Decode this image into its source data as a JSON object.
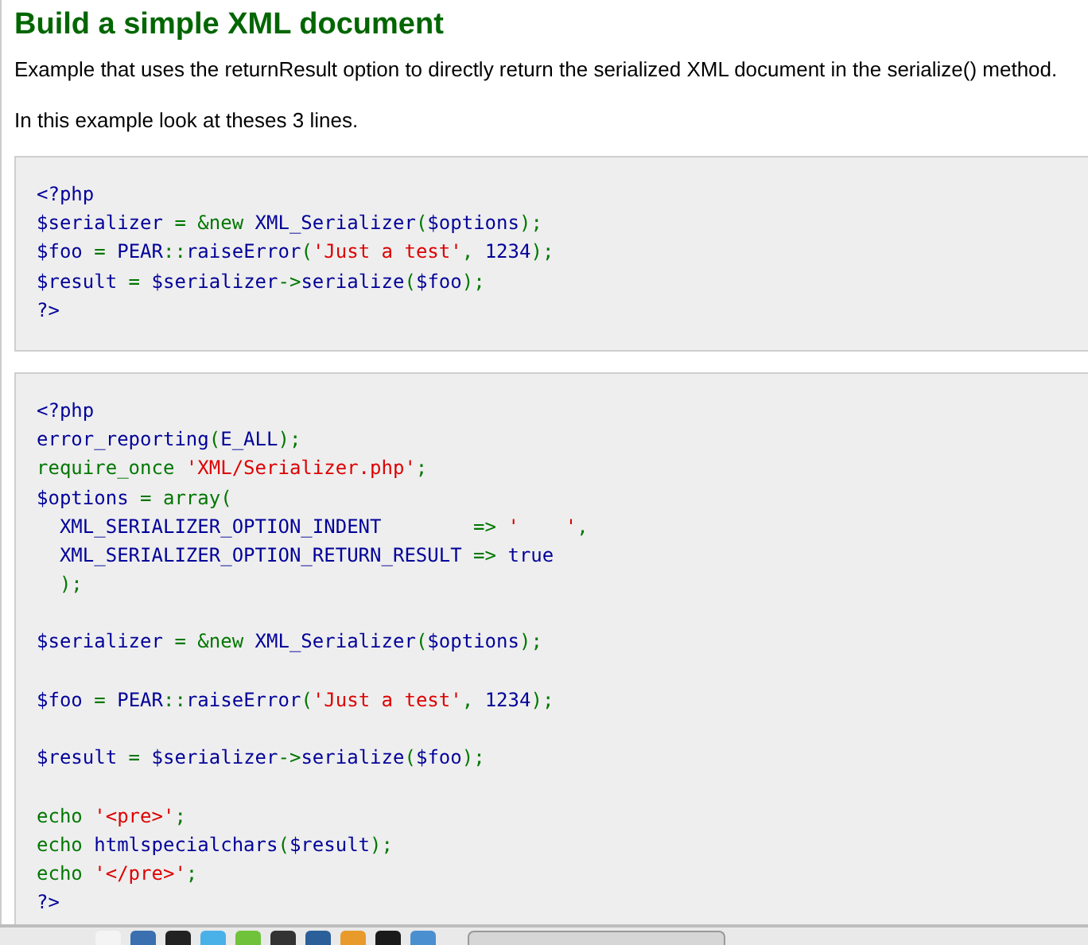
{
  "heading": "Build a simple XML document",
  "paragraphs": [
    "Example that uses the returnResult option to directly return the serialized XML document in the serialize() method.",
    "In this example look at theses 3 lines."
  ],
  "code_blocks": [
    {
      "sections": [
        {
          "lines": [
            [
              {
                "text": "<?php",
                "kind": "plain"
              }
            ],
            [
              {
                "text": "$serializer",
                "kind": "plain"
              },
              {
                "text": " = &new ",
                "kind": "keyword"
              },
              {
                "text": "XML_Serializer",
                "kind": "plain"
              },
              {
                "text": "(",
                "kind": "keyword"
              },
              {
                "text": "$options",
                "kind": "plain"
              },
              {
                "text": ");",
                "kind": "keyword"
              }
            ],
            [
              {
                "text": "$foo",
                "kind": "plain"
              },
              {
                "text": " = ",
                "kind": "keyword"
              },
              {
                "text": "PEAR",
                "kind": "plain"
              },
              {
                "text": "::",
                "kind": "keyword"
              },
              {
                "text": "raiseError",
                "kind": "plain"
              },
              {
                "text": "(",
                "kind": "keyword"
              },
              {
                "text": "'Just a test'",
                "kind": "string"
              },
              {
                "text": ", ",
                "kind": "keyword"
              },
              {
                "text": "1234",
                "kind": "plain"
              },
              {
                "text": ");",
                "kind": "keyword"
              }
            ],
            [
              {
                "text": "$result",
                "kind": "plain"
              },
              {
                "text": " = ",
                "kind": "keyword"
              },
              {
                "text": "$serializer",
                "kind": "plain"
              },
              {
                "text": "->",
                "kind": "keyword"
              },
              {
                "text": "serialize",
                "kind": "plain"
              },
              {
                "text": "(",
                "kind": "keyword"
              },
              {
                "text": "$foo",
                "kind": "plain"
              },
              {
                "text": ");",
                "kind": "keyword"
              }
            ],
            [
              {
                "text": "?>",
                "kind": "plain"
              }
            ]
          ]
        }
      ]
    },
    {
      "sections": [
        {
          "lines": [
            [
              {
                "text": "<?php",
                "kind": "plain"
              }
            ],
            [
              {
                "text": "error_reporting",
                "kind": "plain"
              },
              {
                "text": "(",
                "kind": "keyword"
              },
              {
                "text": "E_ALL",
                "kind": "plain"
              },
              {
                "text": ");",
                "kind": "keyword"
              }
            ],
            [
              {
                "text": "require_once ",
                "kind": "keyword"
              },
              {
                "text": "'XML/Serializer.php'",
                "kind": "string"
              },
              {
                "text": ";",
                "kind": "keyword"
              }
            ],
            [
              {
                "text": "$options",
                "kind": "plain"
              },
              {
                "text": " = ",
                "kind": "keyword"
              },
              {
                "text": "array",
                "kind": "keyword"
              },
              {
                "text": "(",
                "kind": "keyword"
              }
            ],
            [
              {
                "text": "  XML_SERIALIZER_OPTION_INDENT        ",
                "kind": "plain"
              },
              {
                "text": "=> ",
                "kind": "keyword"
              },
              {
                "text": "'    '",
                "kind": "string"
              },
              {
                "text": ",",
                "kind": "keyword"
              }
            ],
            [
              {
                "text": "  XML_SERIALIZER_OPTION_RETURN_RESULT ",
                "kind": "plain"
              },
              {
                "text": "=> ",
                "kind": "keyword"
              },
              {
                "text": "true",
                "kind": "plain"
              }
            ],
            [
              {
                "text": "  );",
                "kind": "keyword"
              }
            ]
          ]
        },
        {
          "lines": [
            [
              {
                "text": "$serializer",
                "kind": "plain"
              },
              {
                "text": " = &new ",
                "kind": "keyword"
              },
              {
                "text": "XML_Serializer",
                "kind": "plain"
              },
              {
                "text": "(",
                "kind": "keyword"
              },
              {
                "text": "$options",
                "kind": "plain"
              },
              {
                "text": ");",
                "kind": "keyword"
              }
            ]
          ]
        },
        {
          "lines": [
            [
              {
                "text": "$foo",
                "kind": "plain"
              },
              {
                "text": " = ",
                "kind": "keyword"
              },
              {
                "text": "PEAR",
                "kind": "plain"
              },
              {
                "text": "::",
                "kind": "keyword"
              },
              {
                "text": "raiseError",
                "kind": "plain"
              },
              {
                "text": "(",
                "kind": "keyword"
              },
              {
                "text": "'Just a test'",
                "kind": "string"
              },
              {
                "text": ", ",
                "kind": "keyword"
              },
              {
                "text": "1234",
                "kind": "plain"
              },
              {
                "text": ");",
                "kind": "keyword"
              }
            ]
          ]
        },
        {
          "lines": [
            [
              {
                "text": "$result",
                "kind": "plain"
              },
              {
                "text": " = ",
                "kind": "keyword"
              },
              {
                "text": "$serializer",
                "kind": "plain"
              },
              {
                "text": "->",
                "kind": "keyword"
              },
              {
                "text": "serialize",
                "kind": "plain"
              },
              {
                "text": "(",
                "kind": "keyword"
              },
              {
                "text": "$foo",
                "kind": "plain"
              },
              {
                "text": ");",
                "kind": "keyword"
              }
            ]
          ]
        },
        {
          "lines": [
            [
              {
                "text": "echo ",
                "kind": "keyword"
              },
              {
                "text": "'<pre>'",
                "kind": "string"
              },
              {
                "text": ";",
                "kind": "keyword"
              }
            ],
            [
              {
                "text": "echo ",
                "kind": "keyword"
              },
              {
                "text": "htmlspecialchars",
                "kind": "plain"
              },
              {
                "text": "(",
                "kind": "keyword"
              },
              {
                "text": "$result",
                "kind": "plain"
              },
              {
                "text": ");",
                "kind": "keyword"
              }
            ],
            [
              {
                "text": "echo ",
                "kind": "keyword"
              },
              {
                "text": "'</pre>'",
                "kind": "string"
              },
              {
                "text": ";",
                "kind": "keyword"
              }
            ],
            [
              {
                "text": "?>",
                "kind": "plain"
              }
            ]
          ]
        }
      ]
    }
  ]
}
